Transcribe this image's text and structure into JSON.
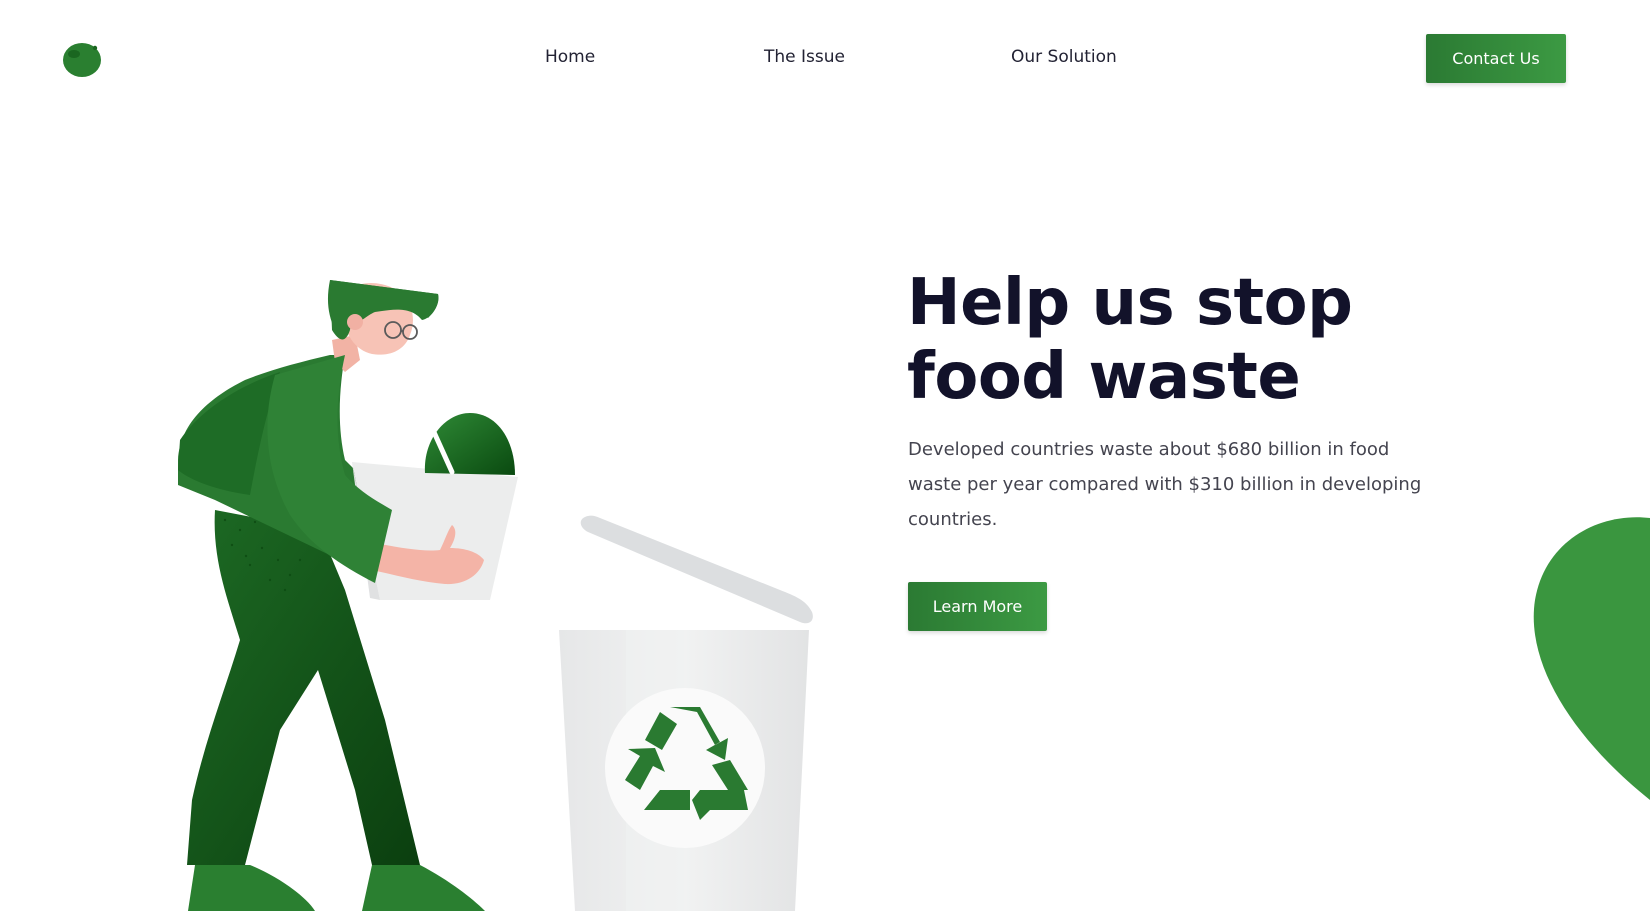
{
  "header": {
    "logo_icon": "lime-icon",
    "nav": [
      {
        "label": "Home"
      },
      {
        "label": "The Issue"
      },
      {
        "label": "Our Solution"
      }
    ],
    "contact_label": "Contact Us"
  },
  "hero": {
    "title_line1": "Help us stop",
    "title_line2": "food waste",
    "description": "Developed countries waste about $680 billion in food waste per year compared with $310 billion in developing countries.",
    "cta_label": "Learn More"
  },
  "colors": {
    "brand_green": "#2e7d32",
    "accent_green": "#3c9a43",
    "dark_green": "#0f4d12",
    "title_color": "#12122a"
  }
}
